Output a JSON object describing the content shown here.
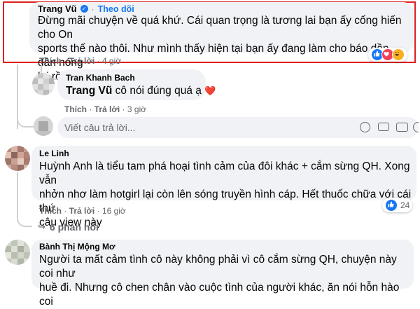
{
  "comments": [
    {
      "author": "Trang Vũ",
      "follow_label": "Theo dõi",
      "lines": [
        "Đừng mãi chuyện về quá khứ. Cái quan trọng là tương lai bạn ấy cống hiến cho On",
        "sports thế nào thôi. Như mình thấy hiện tại bạn ấy đang làm cho báo dần dần nóng",
        "lại rồi"
      ],
      "emoji": "💪😎",
      "like": "Thích",
      "reply": "Trả lời",
      "time": "4 giờ",
      "reactions": [
        "like",
        "love",
        "haha"
      ]
    },
    {
      "author": "Tran Khanh Bach",
      "mention": "Trang Vũ",
      "text": "cô nói đúng quá ạ",
      "emoji": "❤️",
      "like": "Thích",
      "reply": "Trả lời",
      "time": "3 giờ"
    },
    {
      "author": "Le Linh",
      "lines": [
        "Huỳnh Anh là tiểu tam phá hoại tình cảm của đôi khác + cắm sừng QH. Xong vẫn",
        "nhởn nhơ làm hotgirl lại còn lên sóng truyền hình cáp. Hết thuốc chữa với cái thứ",
        "câu view này"
      ],
      "like": "Thích",
      "reply": "Trả lời",
      "time": "16 giờ",
      "reaction_count": "24",
      "replies_label": "6 phản hồi"
    },
    {
      "author": "Bành Thị Mộng Mơ",
      "lines": [
        "Người ta mất cảm tình cô này không phải vì cô cắm sừng QH, chuyện này coi như",
        "huề đi. Nhưng cô chen chân vào cuộc tình của người khác, ăn nói hỗn hào coi"
      ]
    }
  ],
  "reply_input": {
    "placeholder": "Viết câu trả lời...",
    "icons": [
      "emoji-icon",
      "camera-icon",
      "gif-icon",
      "sticker-icon"
    ]
  },
  "colors": {
    "highlight_border": "#e02020",
    "link_blue": "#1877f2",
    "bubble": "#f0f2f5",
    "muted": "#65676b"
  }
}
